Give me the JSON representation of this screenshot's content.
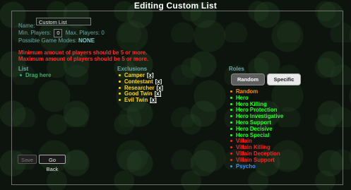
{
  "title": "Editing Custom List",
  "name": {
    "label": "Name:",
    "value": "Custom List"
  },
  "players": {
    "min_label": "Min. Players:",
    "min_value": "0",
    "max_label": "Max. Players:",
    "max_value": "0"
  },
  "modes": {
    "label": "Possible Game Modes:",
    "value": "NONE"
  },
  "errors": [
    "Minimum amount of players should be 5 or more.",
    "Maximum amount of players should be 5 or more."
  ],
  "list": {
    "heading": "List",
    "items": [
      "Drag here"
    ]
  },
  "exclusions": {
    "heading": "Exclusions",
    "remove_label": "[x]",
    "items": [
      "Camper",
      "Contestant",
      "Researcher",
      "Good Twin",
      "Evil Twin"
    ]
  },
  "roles": {
    "heading": "Roles",
    "buttons": {
      "random": "Random",
      "specific": "Specific"
    },
    "items": [
      {
        "label": "Random",
        "color": "#ff8a00"
      },
      {
        "label": "Hero",
        "color": "#2dff2d"
      },
      {
        "label": "Hero Killing",
        "color": "#2dff2d"
      },
      {
        "label": "Hero Protection",
        "color": "#2dff2d"
      },
      {
        "label": "Hero Investigative",
        "color": "#2dff2d"
      },
      {
        "label": "Hero Support",
        "color": "#2dff2d"
      },
      {
        "label": "Hero Decisive",
        "color": "#2dff2d"
      },
      {
        "label": "Hero Special",
        "color": "#2dff2d"
      },
      {
        "label": "Villain",
        "color": "#ff2222"
      },
      {
        "label": "Villain Killing",
        "color": "#ff2222"
      },
      {
        "label": "Villain Deception",
        "color": "#ff2222"
      },
      {
        "label": "Villain Support",
        "color": "#ff2222"
      },
      {
        "label": "Psycho",
        "color": "#4d8ff0"
      }
    ]
  },
  "buttons": {
    "save": "Save",
    "go_back": "Go Back"
  }
}
